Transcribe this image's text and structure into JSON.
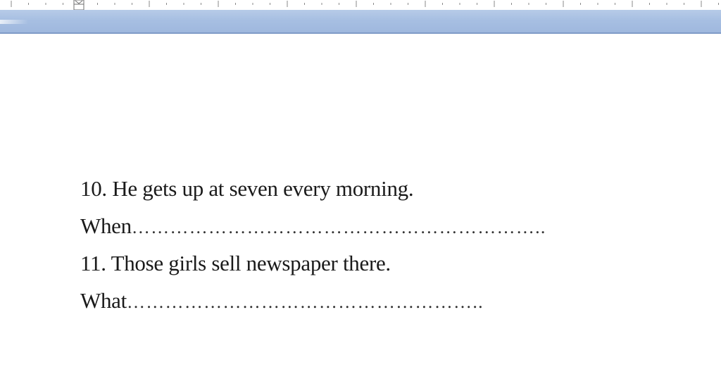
{
  "colors": {
    "ribbon": "#a7bfe2",
    "ribbon_border": "#7f9bc7",
    "text": "#1a1a1a"
  },
  "ruler": {
    "indent_marker_icon": "hourglass-indent-icon"
  },
  "document": {
    "lines": [
      {
        "number": "10.",
        "text": "He gets up at seven every morning."
      },
      {
        "prompt": "When",
        "dots": "……………………………………………………….."
      },
      {
        "number": "11.",
        "text": "Those girls sell newspaper there."
      },
      {
        "prompt": "What",
        "dots": "……………………………………………….."
      }
    ]
  }
}
